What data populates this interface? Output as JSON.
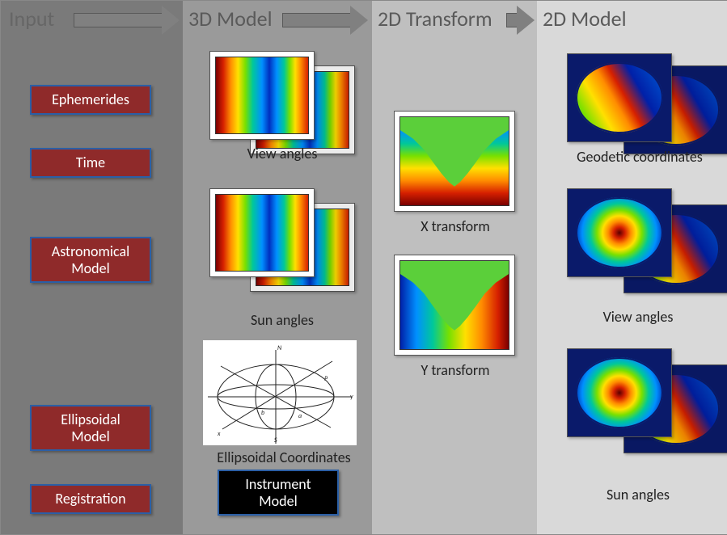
{
  "headers": {
    "input": "Input",
    "model3d": "3D Model",
    "transform2d": "2D Transform",
    "model2d": "2D Model"
  },
  "input_boxes": {
    "ephemerides": "Ephemerides",
    "time": "Time",
    "astronomical_model": "Astronomical\nModel",
    "ellipsoidal_model": "Ellipsoidal\nModel",
    "registration": "Registration"
  },
  "model3d": {
    "view_angles_caption": "View angles",
    "sun_angles_caption": "Sun angles",
    "ellipsoidal_coords_caption": "Ellipsoidal Coordinates",
    "instrument_model": "Instrument\nModel"
  },
  "transform2d": {
    "x_caption": "X transform",
    "y_caption": "Y transform"
  },
  "model2d": {
    "geodetic_caption": "Geodetic coordinates",
    "view_angles_caption": "View angles",
    "sun_angles_caption": "Sun angles"
  }
}
